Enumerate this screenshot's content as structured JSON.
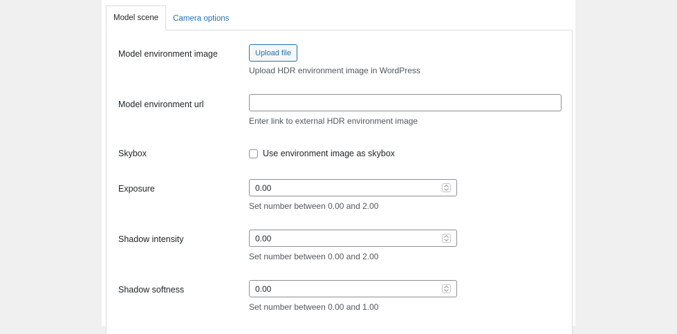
{
  "tabs": [
    {
      "label": "Model scene",
      "active": true
    },
    {
      "label": "Camera options",
      "active": false
    }
  ],
  "fields": {
    "environment_image": {
      "label": "Model environment image",
      "button_label": "Upload file",
      "description": "Upload HDR environment image in WordPress"
    },
    "environment_url": {
      "label": "Model environment url",
      "value": "",
      "placeholder": "",
      "description": "Enter link to external HDR environment image"
    },
    "skybox": {
      "label": "Skybox",
      "checkbox_label": "Use environment image as skybox",
      "checked": false
    },
    "exposure": {
      "label": "Exposure",
      "value": "0.00",
      "description": "Set number between 0.00 and 2.00"
    },
    "shadow_intensity": {
      "label": "Shadow intensity",
      "value": "0.00",
      "description": "Set number between 0.00 and 2.00"
    },
    "shadow_softness": {
      "label": "Shadow softness",
      "value": "0.00",
      "description": "Set number between 0.00 and 1.00"
    }
  },
  "colors": {
    "accent": "#2271b1",
    "border": "#dcdcde",
    "background": "#f0f0f1"
  }
}
